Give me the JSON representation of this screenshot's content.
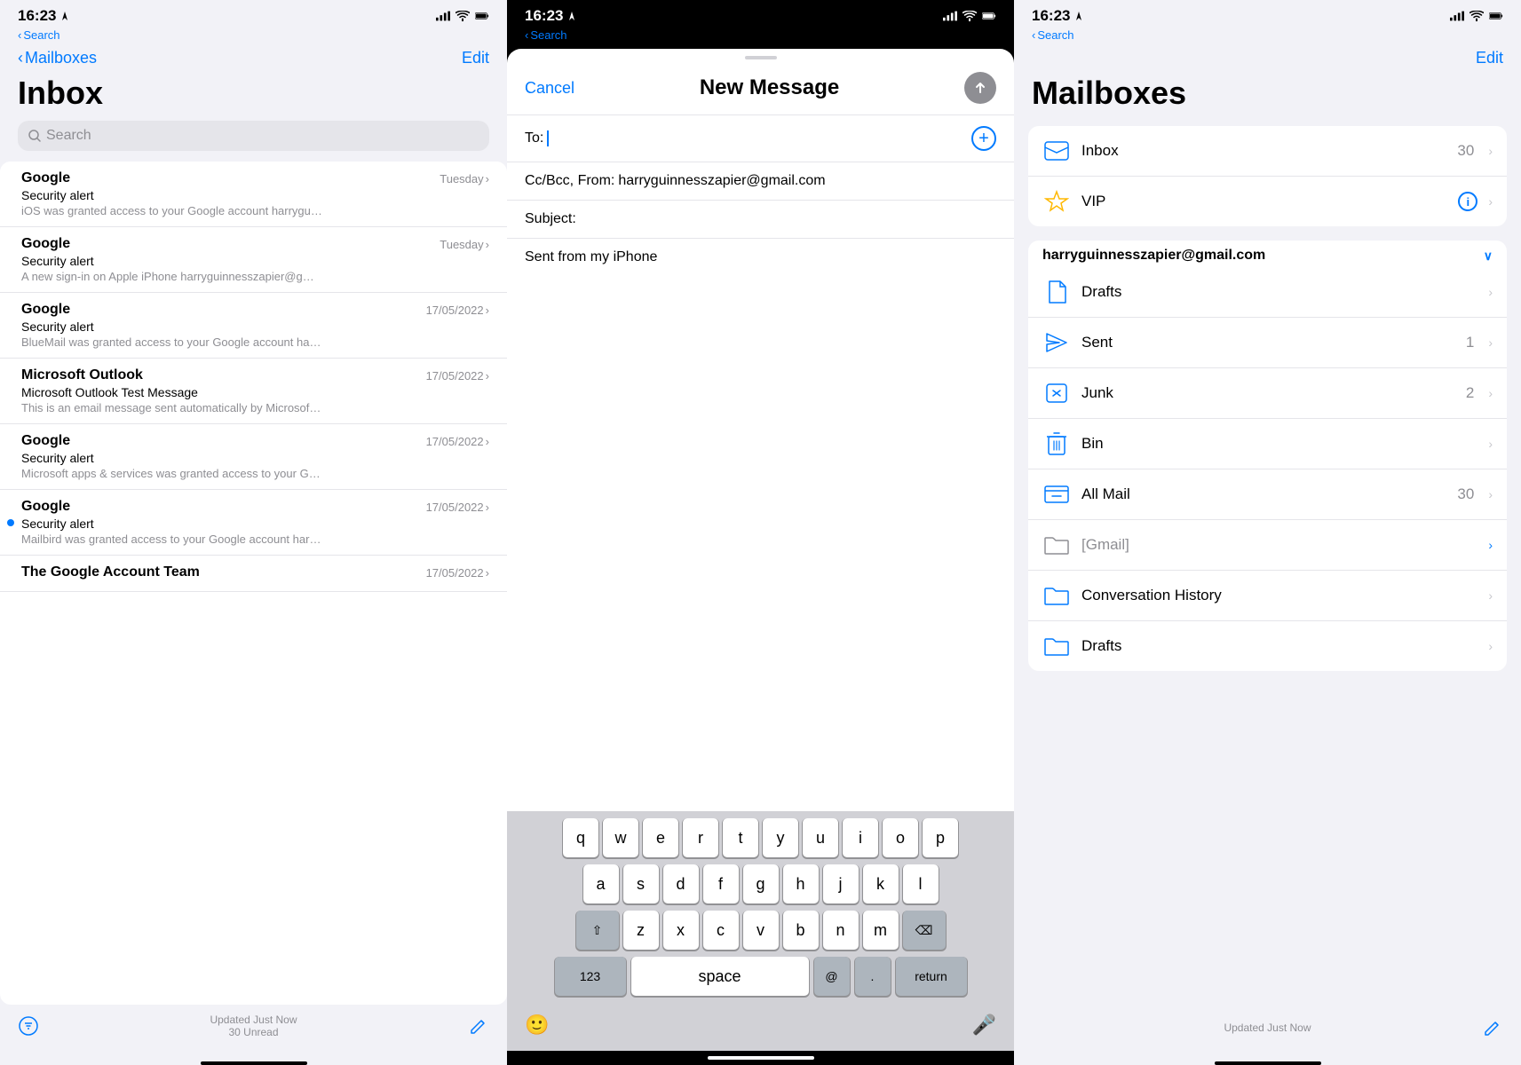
{
  "panel1": {
    "time": "16:23",
    "back": "Search",
    "mailboxes_link": "Mailboxes",
    "edit": "Edit",
    "title": "Inbox",
    "search_placeholder": "Search",
    "emails": [
      {
        "sender": "Google",
        "date": "Tuesday",
        "subject": "Security alert",
        "preview": "iOS was granted access to your Google account harryguinnesszapier@gmail.com If you did not gran...",
        "unread": false
      },
      {
        "sender": "Google",
        "date": "Tuesday",
        "subject": "Security alert",
        "preview": "A new sign-in on Apple iPhone harryguinnesszapier@gmail.com We noticed a new...",
        "unread": false
      },
      {
        "sender": "Google",
        "date": "17/05/2022",
        "subject": "Security alert",
        "preview": "BlueMail was granted access to your Google account harryguinnesszapier@gmail.com If you did not gran...",
        "unread": false
      },
      {
        "sender": "Microsoft Outlook",
        "date": "17/05/2022",
        "subject": "Microsoft Outlook Test Message",
        "preview": "This is an email message sent automatically by Microsoft Outlook while testing the settings for you...",
        "unread": false
      },
      {
        "sender": "Google",
        "date": "17/05/2022",
        "subject": "Security alert",
        "preview": "Microsoft apps & services was granted access to your Google account harryguinnesszapier@gmail.c...",
        "unread": false
      },
      {
        "sender": "Google",
        "date": "17/05/2022",
        "subject": "Security alert",
        "preview": "Mailbird was granted access to your Google account harryguinnesszapier@gmail.com If you did not gran...",
        "unread": true
      },
      {
        "sender": "The Google Account Team",
        "date": "17/05/2022",
        "subject": "",
        "preview": "",
        "unread": false
      }
    ],
    "bottom_status": "Updated Just Now",
    "bottom_unread": "30 Unread"
  },
  "panel2": {
    "time": "16:23",
    "back": "Search",
    "cancel": "Cancel",
    "title": "New Message",
    "to_label": "To:",
    "cc_label": "Cc/Bcc, From:",
    "cc_value": "harryguinnesszapier@gmail.com",
    "subject_label": "Subject:",
    "body": "Sent from my iPhone",
    "keyboard_rows": [
      [
        "q",
        "w",
        "e",
        "r",
        "t",
        "y",
        "u",
        "i",
        "o",
        "p"
      ],
      [
        "a",
        "s",
        "d",
        "f",
        "g",
        "h",
        "j",
        "k",
        "l"
      ],
      [
        "z",
        "x",
        "c",
        "v",
        "b",
        "n",
        "m"
      ],
      [
        "123",
        "space",
        "@",
        ".",
        "return"
      ]
    ]
  },
  "panel3": {
    "time": "16:23",
    "back": "Search",
    "edit": "Edit",
    "title": "Mailboxes",
    "vip_inbox": [
      {
        "label": "Inbox",
        "count": "30",
        "icon": "inbox-icon"
      },
      {
        "label": "VIP",
        "count": "",
        "icon": "vip-icon"
      }
    ],
    "account_email": "harryguinnesszapier@gmail.com",
    "account_folders": [
      {
        "label": "Drafts",
        "count": "",
        "icon": "drafts-icon"
      },
      {
        "label": "Sent",
        "count": "1",
        "icon": "sent-icon"
      },
      {
        "label": "Junk",
        "count": "2",
        "icon": "junk-icon"
      },
      {
        "label": "Bin",
        "count": "",
        "icon": "bin-icon"
      },
      {
        "label": "All Mail",
        "count": "30",
        "icon": "allmail-icon"
      },
      {
        "label": "[Gmail]",
        "count": "",
        "icon": "folder-icon",
        "gray": true
      },
      {
        "label": "Conversation History",
        "count": "",
        "icon": "folder-blue-icon"
      },
      {
        "label": "Drafts",
        "count": "",
        "icon": "folder-blue-icon"
      }
    ],
    "bottom_status": "Updated Just Now"
  }
}
